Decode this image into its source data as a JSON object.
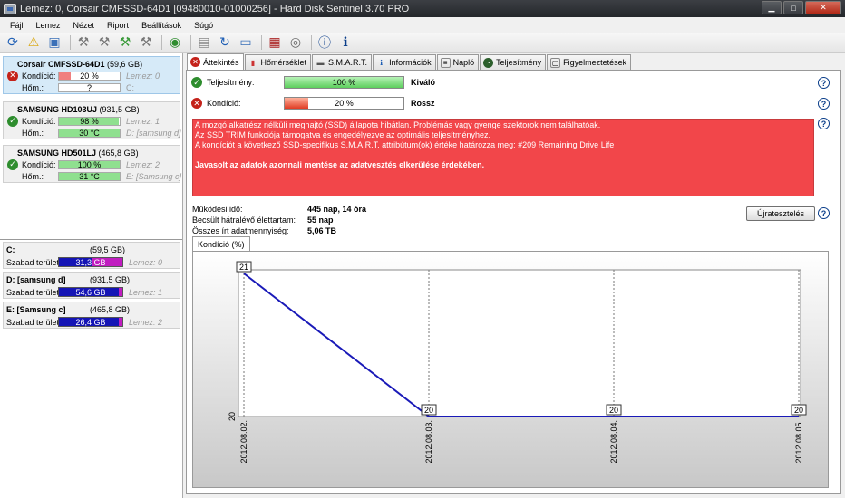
{
  "window": {
    "title": "Lemez: 0, Corsair CMFSSD-64D1 [09480010-01000256]  -  Hard Disk Sentinel 3.70 PRO"
  },
  "menu": [
    "Fájl",
    "Lemez",
    "Nézet",
    "Riport",
    "Beállítások",
    "Súgó"
  ],
  "toolbar_icons": [
    "refresh-icon",
    "warning-icon",
    "disk-icon",
    "tool-icon",
    "tool-icon",
    "tool-icon",
    "tool-icon",
    "globe-icon",
    "document-icon",
    "refresh-doc-icon",
    "monitor-icon",
    "chip-icon",
    "speaker-icon",
    "help-icon",
    "info-icon"
  ],
  "disks": [
    {
      "name": "Corsair CMFSSD-64D1",
      "size": "(59,6 GB)",
      "health_label": "Kondíció:",
      "health": "20 %",
      "health_pct": 20,
      "health_color": "#f08080",
      "disk_index": "Lemez: 0",
      "temp_label": "Hőm.:",
      "temp": "?",
      "temp_pct": 0,
      "temp_color": "#ffffff",
      "letter": "C:",
      "status": "bad"
    },
    {
      "name": "SAMSUNG HD103UJ",
      "size": "(931,5 GB)",
      "health_label": "Kondíció:",
      "health": "98 %",
      "health_pct": 98,
      "health_color": "#8fe08f",
      "disk_index": "Lemez: 1",
      "temp_label": "Hőm.:",
      "temp": "30 °C",
      "temp_pct": 100,
      "temp_color": "#8fe08f",
      "letter": "D: [samsung d]",
      "status": "good"
    },
    {
      "name": "SAMSUNG HD501LJ",
      "size": "(465,8 GB)",
      "health_label": "Kondíció:",
      "health": "100 %",
      "health_pct": 100,
      "health_color": "#8fe08f",
      "disk_index": "Lemez: 2",
      "temp_label": "Hőm.:",
      "temp": "31 °C",
      "temp_pct": 100,
      "temp_color": "#8fe08f",
      "letter": "E: [Samsung c]",
      "status": "good"
    }
  ],
  "volumes": [
    {
      "name": "C:",
      "size": "(59,5 GB)",
      "free_label": "Szabad terület",
      "free": "31,3 GB",
      "free_pct": 53,
      "disk_index": "Lemez: 0"
    },
    {
      "name": "D: [samsung d]",
      "size": "(931,5 GB)",
      "free_label": "Szabad terület",
      "free": "54,6 GB",
      "free_pct": 94,
      "disk_index": "Lemez: 1"
    },
    {
      "name": "E: [Samsung c]",
      "size": "(465,8 GB)",
      "free_label": "Szabad terület",
      "free": "26,4 GB",
      "free_pct": 94,
      "disk_index": "Lemez: 2"
    }
  ],
  "tabs": [
    {
      "label": "Áttekintés",
      "icon": "error-icon",
      "active": true
    },
    {
      "label": "Hőmérséklet",
      "icon": "thermometer-icon"
    },
    {
      "label": "S.M.A.R.T.",
      "icon": "smart-icon"
    },
    {
      "label": "Információk",
      "icon": "info-icon"
    },
    {
      "label": "Napló",
      "icon": "log-icon"
    },
    {
      "label": "Teljesítmény",
      "icon": "performance-icon"
    },
    {
      "label": "Figyelmeztetések",
      "icon": "alerts-icon"
    }
  ],
  "metrics": {
    "performance_label": "Teljesítmény:",
    "performance": "100 %",
    "performance_pct": 100,
    "performance_word": "Kiváló",
    "health_label": "Kondíció:",
    "health": "20 %",
    "health_pct": 20,
    "health_word": "Rossz"
  },
  "alert": {
    "lines": [
      "A mozgó alkatrész nélküli meghajtó (SSD) állapota hibátlan. Problémás vagy gyenge szektorok nem találhatóak.",
      "Az SSD TRIM funkciója támogatva és engedélyezve az optimális teljesítményhez.",
      "A kondíciót a következő SSD-specifikus S.M.A.R.T. attribútum(ok) értéke határozza meg:  #209 Remaining Drive Life"
    ],
    "recommendation": "Javasolt az adatok azonnali mentése az adatvesztés elkerülése érdekében."
  },
  "stats": [
    {
      "label": "Működési idő:",
      "value": "445 nap, 14 óra"
    },
    {
      "label": "Becsült hátralévő élettartam:",
      "value": "55 nap"
    },
    {
      "label": "Összes írt adatmennyiség:",
      "value": "5,06 TB"
    }
  ],
  "reset_button": "Újratesztelés",
  "chart_tab": "Kondíció  (%)",
  "chart_data": {
    "type": "line",
    "x": [
      "2012.08.02.",
      "2012.08.03.",
      "2012.08.04.",
      "2012.08.05."
    ],
    "series": [
      {
        "values": [
          21,
          20,
          20,
          20
        ]
      }
    ],
    "ylim": [
      20,
      21
    ],
    "y_tick_labels": [
      "20"
    ],
    "point_labels": [
      "21",
      "20",
      "20",
      "20"
    ],
    "line_color": "#1a1ab8"
  }
}
